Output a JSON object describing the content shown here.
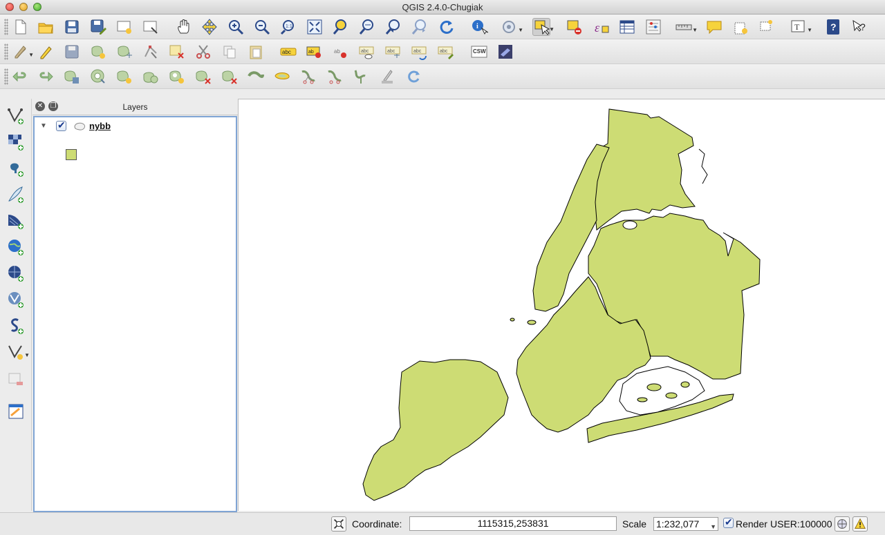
{
  "window": {
    "title": "QGIS 2.4.0-Chugiak"
  },
  "toolbar1": {
    "items": [
      "new-project-icon",
      "open-project-icon",
      "save-project-icon",
      "save-as-icon",
      "new-print-composer-icon",
      "composer-manager-icon",
      "pan-icon",
      "pan-to-selection-icon",
      "zoom-in-icon",
      "zoom-out-icon",
      "zoom-actual-size-icon",
      "zoom-full-icon",
      "zoom-to-selection-icon",
      "zoom-to-layer-icon",
      "zoom-last-icon",
      "zoom-next-icon",
      "refresh-icon",
      "identify-icon",
      "run-feature-action-icon",
      "select-features-icon",
      "deselect-icon",
      "select-by-expression-icon",
      "attribute-table-icon",
      "field-calculator-icon",
      "measure-line-icon",
      "map-tips-icon",
      "new-bookmark-icon",
      "show-bookmarks-icon",
      "text-annotation-icon",
      "help-icon",
      "whats-this-icon"
    ]
  },
  "toolbar2": {
    "items": [
      "current-edits-icon",
      "toggle-editing-icon",
      "save-layer-edits-icon",
      "add-feature-icon",
      "move-feature-icon",
      "node-tool-icon",
      "delete-selected-icon",
      "cut-features-icon",
      "copy-features-icon",
      "paste-features-icon",
      "label-tool-icon",
      "pin-labels-icon",
      "highlight-pinned-labels-icon",
      "show-hide-labels-icon",
      "move-label-icon",
      "rotate-label-icon",
      "change-label-icon",
      "csw-icon",
      "plugin-icon"
    ],
    "csw_label": "CSW"
  },
  "toolbar3": {
    "items": [
      "undo-icon",
      "redo-icon",
      "simplify-feature-icon",
      "add-ring-icon",
      "add-part-icon",
      "fill-ring-icon",
      "delete-ring-icon",
      "delete-part-icon",
      "reshape-features-icon",
      "offset-curve-icon",
      "split-features-icon",
      "split-parts-icon",
      "merge-selected-features-icon",
      "merge-attributes-icon",
      "rotate-point-symbols-icon"
    ]
  },
  "left_toolbar": {
    "items": [
      "add-vector-layer-icon",
      "add-raster-layer-icon",
      "add-postgis-layer-icon",
      "add-spatialite-layer-icon",
      "add-mssql-layer-icon",
      "add-wms-layer-icon",
      "add-wcs-layer-icon",
      "add-wfs-layer-icon",
      "add-delimited-text-icon",
      "new-shapefile-icon",
      "remove-layer-icon",
      "new-spatialite-icon"
    ]
  },
  "layers_panel": {
    "title": "Layers",
    "layers": [
      {
        "name": "nybb",
        "visible": true,
        "fill_color": "#cddc74"
      }
    ]
  },
  "map": {
    "fill_color": "#cddc74",
    "stroke_color": "#000000",
    "background": "#ffffff"
  },
  "statusbar": {
    "coordinate_label": "Coordinate:",
    "coordinate_value": "1115315,253831",
    "scale_label": "Scale",
    "scale_value": "1:232,077",
    "render_label": "Render",
    "render_checked": true,
    "crs_label": "USER:100000"
  }
}
